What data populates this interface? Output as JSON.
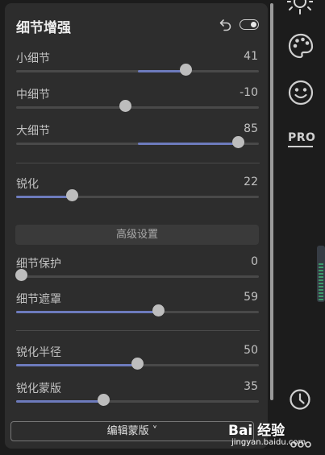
{
  "panel": {
    "title": "细节增强",
    "advanced_label": "高级设置",
    "edit_mask_label": "编辑蒙版 ˅"
  },
  "sliders": [
    {
      "label": "小细节",
      "value": "41",
      "fraction": 0.7,
      "fill_from": 0.5
    },
    {
      "label": "中细节",
      "value": "-10",
      "fraction": 0.45,
      "fill_from": 0.45
    },
    {
      "label": "大细节",
      "value": "85",
      "fraction": 0.915,
      "fill_from": 0.5
    },
    {
      "label": "锐化",
      "value": "22",
      "fraction": 0.23,
      "fill_from": 0.0
    },
    {
      "label": "细节保护",
      "value": "0",
      "fraction": 0.02,
      "fill_from": 0.0
    },
    {
      "label": "细节遮罩",
      "value": "59",
      "fraction": 0.585,
      "fill_from": 0.0
    },
    {
      "label": "锐化半径",
      "value": "50",
      "fraction": 0.5,
      "fill_from": 0.0
    },
    {
      "label": "锐化蒙版",
      "value": "35",
      "fraction": 0.36,
      "fill_from": 0.0
    }
  ],
  "sidebar": {
    "pro_label": "PRO"
  },
  "watermark": {
    "brand": "Bai 经验",
    "domain": "jingyan.baidu.com"
  },
  "colors": {
    "accent": "#6d7bbd",
    "panel": "#2d2d2d",
    "background": "#1c1c1c"
  },
  "icons": [
    "undo-icon",
    "toggle-switch",
    "sun-icon",
    "palette-icon",
    "smiley-icon",
    "pro-icon",
    "history-clock-icon",
    "more-dots-icon"
  ]
}
